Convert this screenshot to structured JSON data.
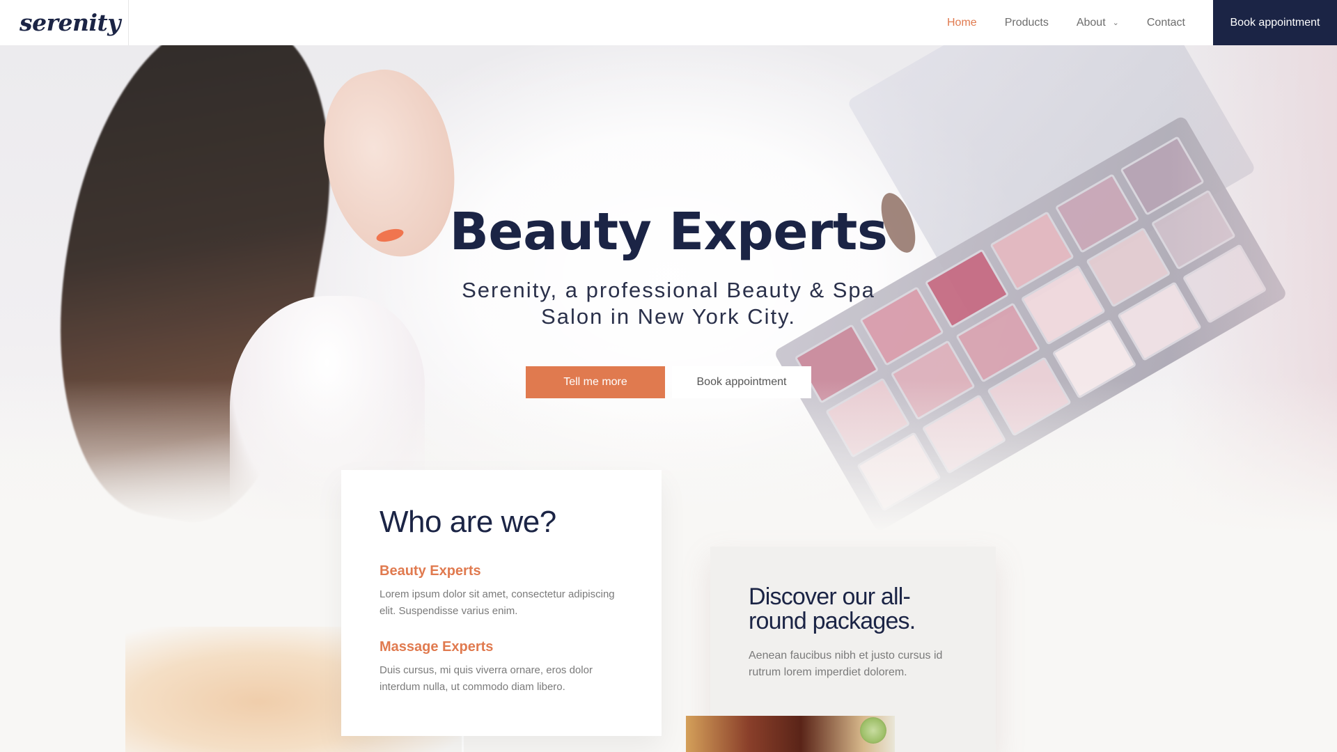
{
  "brand": {
    "logo_text": "serenity"
  },
  "nav": {
    "links": [
      {
        "label": "Home",
        "active": true
      },
      {
        "label": "Products",
        "active": false
      },
      {
        "label": "About",
        "active": false,
        "has_dropdown": true
      },
      {
        "label": "Contact",
        "active": false
      }
    ],
    "cta_label": "Book appointment"
  },
  "hero": {
    "title": "Beauty Experts",
    "subtitle": "Serenity, a professional Beauty & Spa Salon in New York City.",
    "primary_button": "Tell me more",
    "secondary_button": "Book appointment"
  },
  "who": {
    "heading": "Who are we?",
    "items": [
      {
        "title": "Beauty Experts",
        "text": "Lorem ipsum dolor sit amet, consectetur adipiscing elit. Suspendisse varius enim."
      },
      {
        "title": "Massage Experts",
        "text": "Duis cursus, mi quis viverra ornare, eros dolor interdum nulla, ut commodo diam libero."
      }
    ]
  },
  "packages": {
    "heading": "Discover our all-round packages.",
    "text": "Aenean faucibus nibh et justo cursus id rutrum lorem imperdiet dolorem."
  },
  "colors": {
    "accent": "#e07a4f",
    "navy": "#1b2445",
    "palette_pans": [
      "#c98a9c",
      "#d89cab",
      "#c56b83",
      "#e3b8c0",
      "#c9a7b7",
      "#b6a3b3",
      "#e8c9cf",
      "#dcb0bb",
      "#d7a2b0",
      "#efd8dc",
      "#e2cbd0",
      "#cdbec8",
      "#f2e2e4",
      "#ecd5da",
      "#e9cfd5",
      "#f5e8ea",
      "#eee0e4",
      "#e6dde3"
    ]
  }
}
